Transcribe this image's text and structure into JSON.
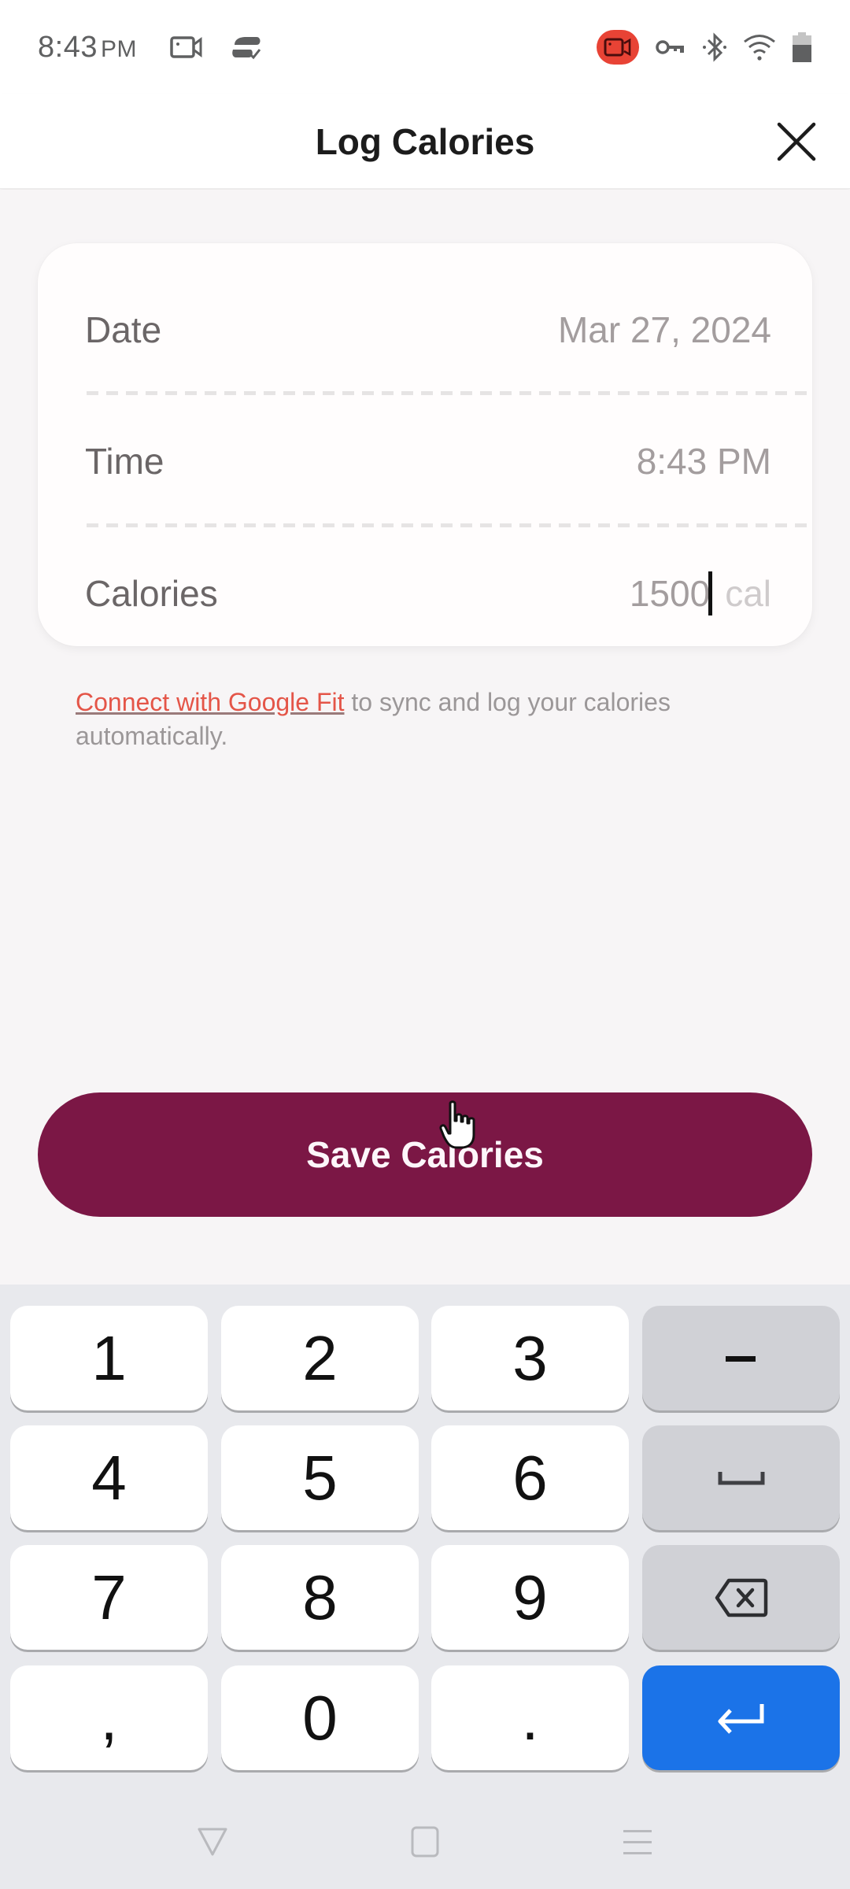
{
  "status_bar": {
    "time": "8:43",
    "ampm": "PM",
    "left_icons": [
      "screen-record-icon",
      "sync-check-icon"
    ],
    "right_icons": [
      "recording-indicator-icon",
      "vpn-key-icon",
      "bluetooth-icon",
      "wifi-icon",
      "battery-icon"
    ]
  },
  "header": {
    "title": "Log Calories",
    "close_icon": "close-icon"
  },
  "form": {
    "rows": [
      {
        "label": "Date",
        "value": "Mar 27, 2024"
      },
      {
        "label": "Time",
        "value": "8:43 PM"
      },
      {
        "label": "Calories",
        "value": "1500",
        "unit": "cal"
      }
    ]
  },
  "sync_note": {
    "link": "Connect with Google Fit",
    "text": " to sync and log your calories automatically."
  },
  "save_button": {
    "label": "Save Calories",
    "color": "#7b1745"
  },
  "keyboard": {
    "keys": [
      [
        "1",
        "2",
        "3",
        "−"
      ],
      [
        "4",
        "5",
        "6",
        "space-icon"
      ],
      [
        "7",
        "8",
        "9",
        "backspace-icon"
      ],
      [
        ",",
        "0",
        ".",
        "enter-icon"
      ]
    ],
    "enter_color": "#1b73e8"
  },
  "nav_bar": {
    "buttons": [
      "back-icon",
      "home-icon",
      "recents-icon"
    ]
  }
}
